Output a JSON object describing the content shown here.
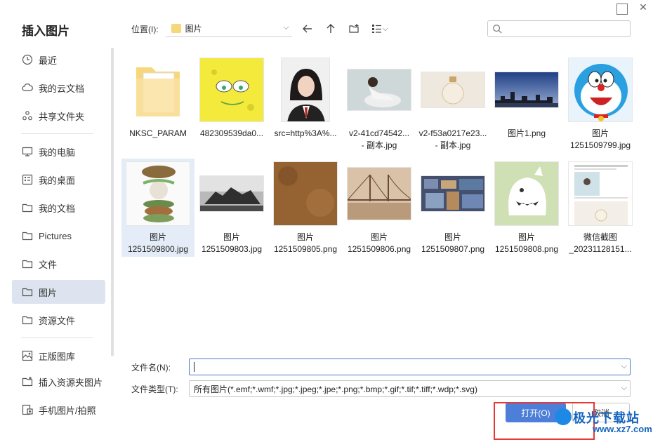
{
  "dialog": {
    "title": "插入图片"
  },
  "colors": {
    "accent": "#4d7fd8",
    "active_bg": "#dde4ef",
    "highlight": "#e53935",
    "folder": "#f6d77a"
  },
  "sidebar": {
    "items": [
      {
        "label": "最近",
        "icon": "clock-icon"
      },
      {
        "label": "我的云文档",
        "icon": "cloud-icon"
      },
      {
        "label": "共享文件夹",
        "icon": "share-icon"
      },
      {
        "label": "我的电脑",
        "icon": "monitor-icon"
      },
      {
        "label": "我的桌面",
        "icon": "desktop-icon"
      },
      {
        "label": "我的文档",
        "icon": "folder-icon"
      },
      {
        "label": "Pictures",
        "icon": "folder-icon"
      },
      {
        "label": "文件",
        "icon": "folder-icon"
      },
      {
        "label": "图片",
        "icon": "folder-icon",
        "active": true
      },
      {
        "label": "资源文件",
        "icon": "folder-icon"
      },
      {
        "label": "正版图库",
        "icon": "image-library-icon"
      },
      {
        "label": "插入资源夹图片",
        "icon": "insert-image-icon"
      },
      {
        "label": "手机图片/拍照",
        "icon": "phone-image-icon"
      }
    ]
  },
  "toolbar": {
    "location_label": "位置(I):",
    "location_value": "图片",
    "search_placeholder": ""
  },
  "files": [
    {
      "line1": "NKSC_PARAM",
      "line2": "",
      "kind": "folder"
    },
    {
      "line1": "482309539da0...",
      "line2": "",
      "kind": "sponge"
    },
    {
      "line1": "src=http%3A%...",
      "line2": "",
      "kind": "portrait"
    },
    {
      "line1": "v2-41cd74542...",
      "line2": "- 副本.jpg",
      "kind": "girl"
    },
    {
      "line1": "v2-f53a0217e23...",
      "line2": "- 副本.jpg",
      "kind": "bottle"
    },
    {
      "line1": "图片1.png",
      "line2": "",
      "kind": "city"
    },
    {
      "line1": "图片",
      "line2": "1251509799.jpg",
      "kind": "doraemon"
    },
    {
      "line1": "图片",
      "line2": "1251509800.jpg",
      "kind": "burger",
      "selected": true
    },
    {
      "line1": "图片",
      "line2": "1251509803.jpg",
      "kind": "rock"
    },
    {
      "line1": "图片",
      "line2": "1251509805.png",
      "kind": "leather"
    },
    {
      "line1": "图片",
      "line2": "1251509806.png",
      "kind": "bridge"
    },
    {
      "line1": "图片",
      "line2": "1251509807.png",
      "kind": "collage"
    },
    {
      "line1": "图片",
      "line2": "1251509808.png",
      "kind": "monster"
    },
    {
      "line1": "微信截图",
      "line2": "_20231128151...",
      "kind": "doc"
    }
  ],
  "filename": {
    "label": "文件名(N):",
    "value": ""
  },
  "filetype": {
    "label": "文件类型(T):",
    "value": "所有图片(*.emf;*.wmf;*.jpg;*.jpeg;*.jpe;*.png;*.bmp;*.gif;*.tif;*.tiff;*.wdp;*.svg)"
  },
  "buttons": {
    "open": "打开(O)",
    "cancel": "取消"
  },
  "watermark": {
    "text": "极光下载站",
    "url": "www.xz7.com"
  }
}
